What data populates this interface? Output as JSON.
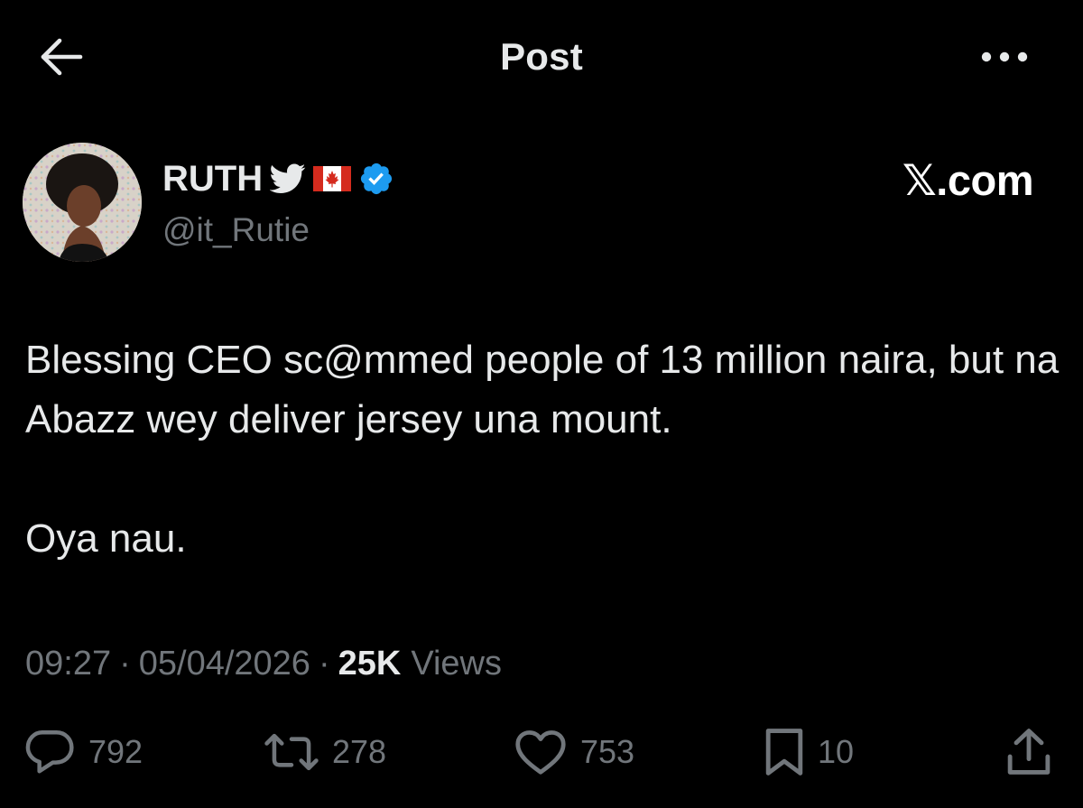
{
  "header": {
    "title": "Post",
    "back_icon": "arrow-left-icon",
    "more_icon": "more-horizontal-icon"
  },
  "author": {
    "display_name": "RUTH",
    "handle": "@it_Rutie",
    "badges": [
      "bird-icon",
      "canada-flag-icon",
      "verified-badge-icon"
    ],
    "verified_color": "#1d9bf0"
  },
  "brand_mark": "𝕏.com",
  "tweet": {
    "paragraphs": [
      "Blessing CEO sc@mmed people of 13 million naira, but na Abazz wey deliver jersey una mount.",
      "Oya nau."
    ]
  },
  "meta": {
    "time": "09:27",
    "separator": "·",
    "date": "05/04/2026",
    "views_count": "25K",
    "views_label": "Views"
  },
  "actions": {
    "replies": "792",
    "reposts": "278",
    "likes": "753",
    "bookmarks": "10"
  },
  "colors": {
    "background": "#000000",
    "primary_text": "#e7e9ea",
    "secondary_text": "#71767b",
    "accent": "#1d9bf0"
  }
}
